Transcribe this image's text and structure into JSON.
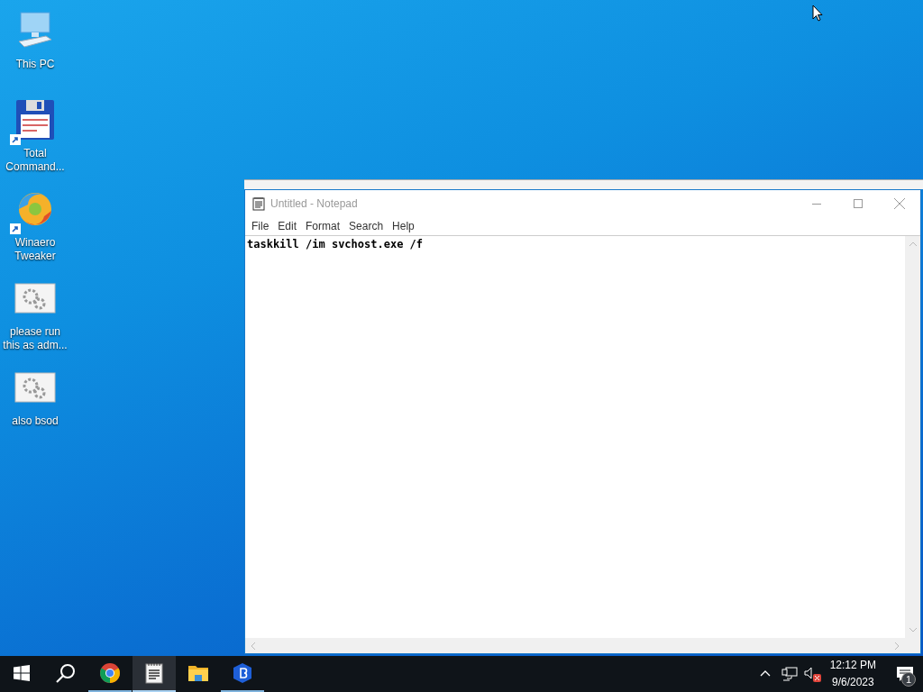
{
  "desktop_icons": [
    {
      "kind": "pc",
      "label": "This PC",
      "shortcut": false
    },
    {
      "kind": "floppy",
      "label": "Total Command...",
      "shortcut": true
    },
    {
      "kind": "swirl",
      "label": "Winaero Tweaker",
      "shortcut": true
    },
    {
      "kind": "gears",
      "label": "please run this as adm...",
      "shortcut": false
    },
    {
      "kind": "gears",
      "label": "also bsod",
      "shortcut": false
    }
  ],
  "window": {
    "title": "Untitled - Notepad",
    "menu": [
      "File",
      "Edit",
      "Format",
      "Search",
      "Help"
    ],
    "text": "taskkill /im svchost.exe /f"
  },
  "taskbar": {
    "apps": [
      {
        "kind": "chrome",
        "running": true,
        "active": false
      },
      {
        "kind": "notepad",
        "running": true,
        "active": true
      },
      {
        "kind": "explorer",
        "running": false,
        "active": false
      },
      {
        "kind": "app",
        "running": true,
        "active": false
      }
    ],
    "volume_muted": true,
    "time": "12:12 PM",
    "date": "9/6/2023",
    "notification_count": "1"
  }
}
